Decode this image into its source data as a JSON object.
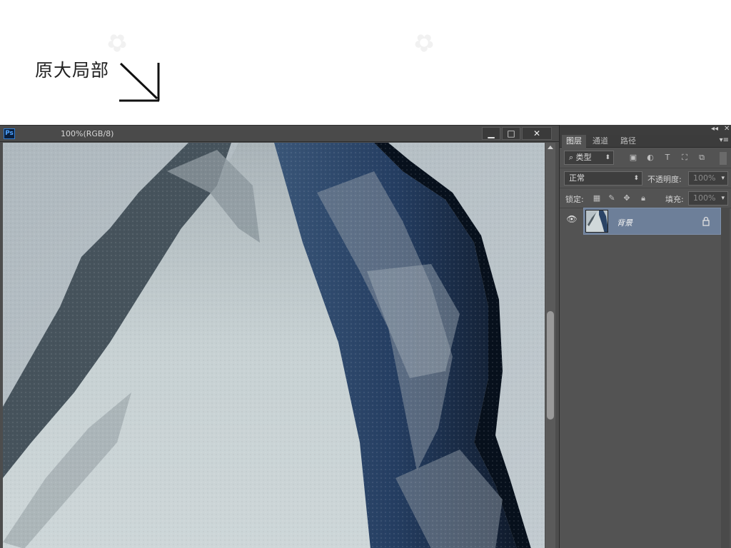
{
  "annotation": {
    "caption": "原大局部"
  },
  "document": {
    "title": "100%(RGB/8)",
    "app_icon": "Ps",
    "buttons": {
      "minimize": "▁",
      "maximize": "□",
      "close": "✕"
    }
  },
  "layers_panel": {
    "tabs": [
      {
        "label": "图层",
        "active": true
      },
      {
        "label": "通道",
        "active": false
      },
      {
        "label": "路径",
        "active": false
      }
    ],
    "filter": {
      "kind_label": "类型"
    },
    "blend": {
      "mode": "正常",
      "opacity_label": "不透明度:",
      "opacity_value": "100%"
    },
    "lock": {
      "label": "锁定:",
      "fill_label": "填充:",
      "fill_value": "100%"
    },
    "layers": [
      {
        "name": "背景",
        "visible": true,
        "locked": true
      }
    ]
  },
  "colors": {
    "accent": "#6d7f99",
    "panel_bg": "#535353",
    "ps_blue": "#2f7dd6"
  },
  "icons": [
    "search-icon",
    "image-filter-icon",
    "adjustment-filter-icon",
    "text-filter-icon",
    "shape-filter-icon",
    "smart-object-filter-icon",
    "lock-transparent-icon",
    "lock-paint-icon",
    "lock-position-icon",
    "lock-all-icon",
    "eye-icon",
    "lock-icon"
  ]
}
